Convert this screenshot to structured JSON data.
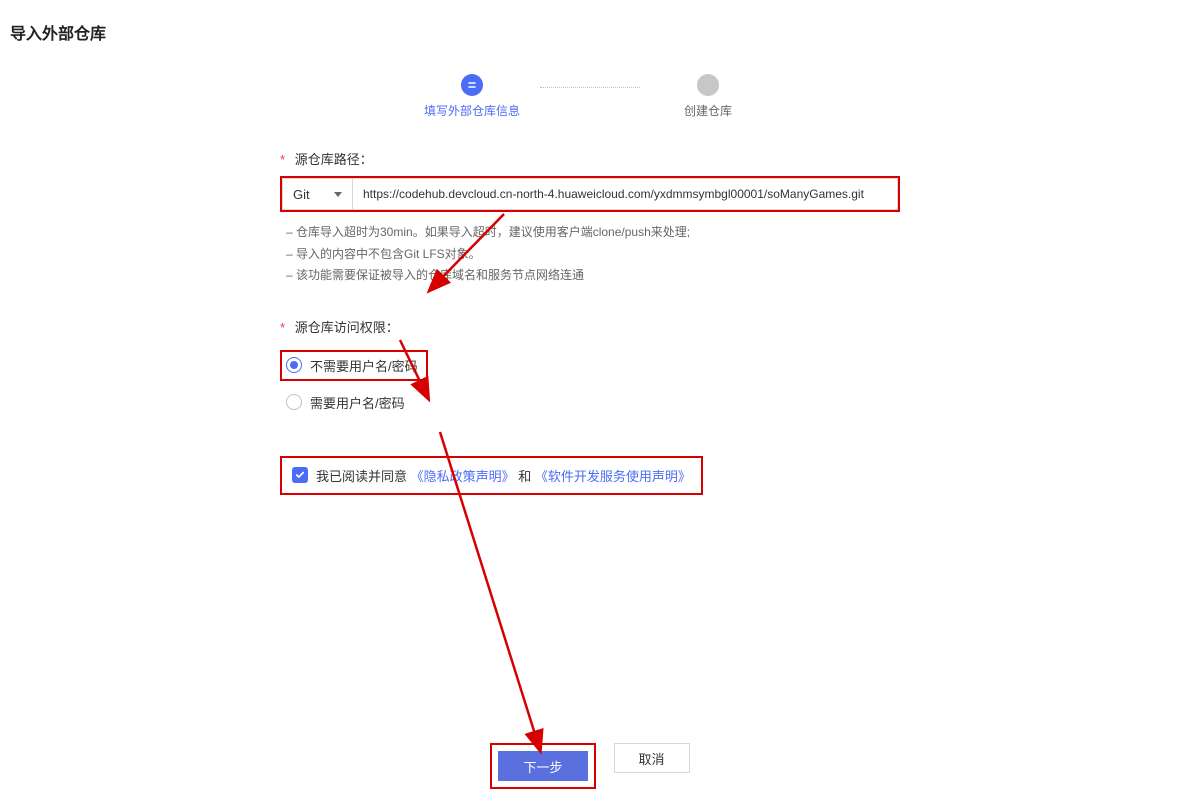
{
  "page_title": "导入外部仓库",
  "stepper": {
    "step1_label": "填写外部仓库信息",
    "step2_label": "创建仓库"
  },
  "form": {
    "source_path_label": "源仓库路径：",
    "protocol_selected": "Git",
    "url_value": "https://codehub.devcloud.cn-north-4.huaweicloud.com/yxdmmsymbgl00001/soManyGames.git",
    "hints": [
      "– 仓库导入超时为30min。如果导入超时，建议使用客户端clone/push来处理;",
      "– 导入的内容中不包含Git LFS对象。",
      "– 该功能需要保证被导入的仓库域名和服务节点网络连通"
    ],
    "access_label": "源仓库访问权限：",
    "access_options": {
      "no_credentials": "不需要用户名/密码",
      "need_credentials": "需要用户名/密码"
    },
    "agreement": {
      "prefix": "我已阅读并同意",
      "privacy_link": "《隐私政策声明》",
      "and": "和",
      "service_link": "《软件开发服务使用声明》"
    }
  },
  "buttons": {
    "next": "下一步",
    "cancel": "取消"
  }
}
